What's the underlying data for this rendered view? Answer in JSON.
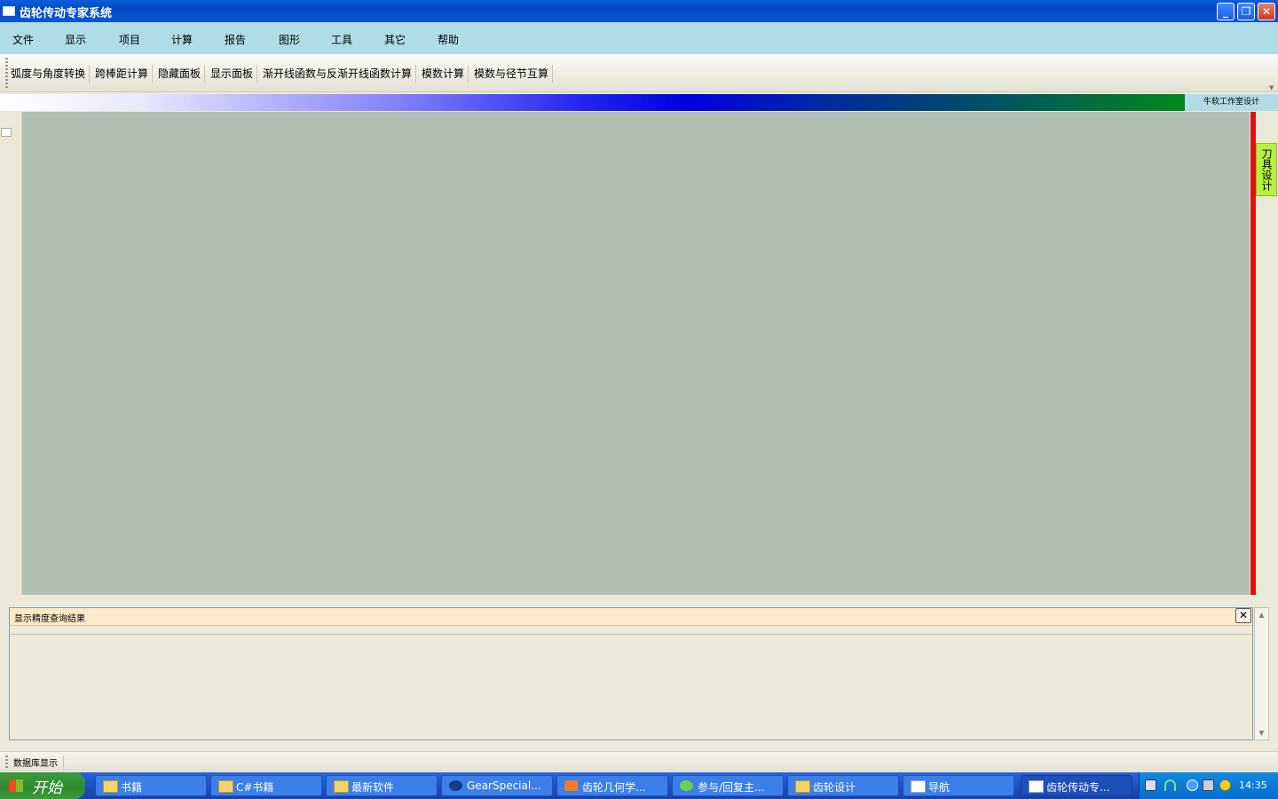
{
  "window": {
    "title": "齿轮传动专家系统",
    "buttons": {
      "minimize": "_",
      "restore": "❐",
      "close": "✕"
    }
  },
  "menubar": [
    {
      "label": "文件"
    },
    {
      "label": "显示"
    },
    {
      "label": "项目"
    },
    {
      "label": "计算"
    },
    {
      "label": "报告"
    },
    {
      "label": "图形"
    },
    {
      "label": "工具"
    },
    {
      "label": "其它"
    },
    {
      "label": "帮助"
    }
  ],
  "toolbar": [
    {
      "label": "弧度与角度转换"
    },
    {
      "label": "跨棒距计算"
    },
    {
      "label": "隐藏面板"
    },
    {
      "label": "显示面板"
    },
    {
      "label": "渐开线函数与反渐开线函数计算"
    },
    {
      "label": "模数计算"
    },
    {
      "label": "模数与径节互算"
    }
  ],
  "banner": {
    "label": "牛软工作室设计"
  },
  "side_tab": {
    "label": "刀具设计"
  },
  "results_panel": {
    "title": "显示精度查询结果",
    "close_glyph": "✕"
  },
  "statusbar": {
    "label": "数据库显示"
  },
  "taskbar": {
    "start_label": "开始",
    "tasks": [
      {
        "label": "书籍",
        "icon": "folder-icon"
      },
      {
        "label": "C#书籍",
        "icon": "folder-icon"
      },
      {
        "label": "最新软件",
        "icon": "folder-icon"
      },
      {
        "label": "GearSpecial...",
        "icon": "gear-icon"
      },
      {
        "label": "齿轮几何学...",
        "icon": "app-icon"
      },
      {
        "label": "参与/回复主...",
        "icon": "browser-icon"
      },
      {
        "label": "齿轮设计",
        "icon": "folder-icon"
      },
      {
        "label": "导航",
        "icon": "window-icon"
      },
      {
        "label": "齿轮传动专...",
        "icon": "window-icon",
        "active": true
      }
    ],
    "clock": "14:35"
  },
  "colors": {
    "menubar_bg": "#b0dce8",
    "workspace_bg": "#b4bfb4",
    "accent_red": "#e01010",
    "side_tab_bg": "#b8f040",
    "results_header_bg": "#fde9c8"
  }
}
